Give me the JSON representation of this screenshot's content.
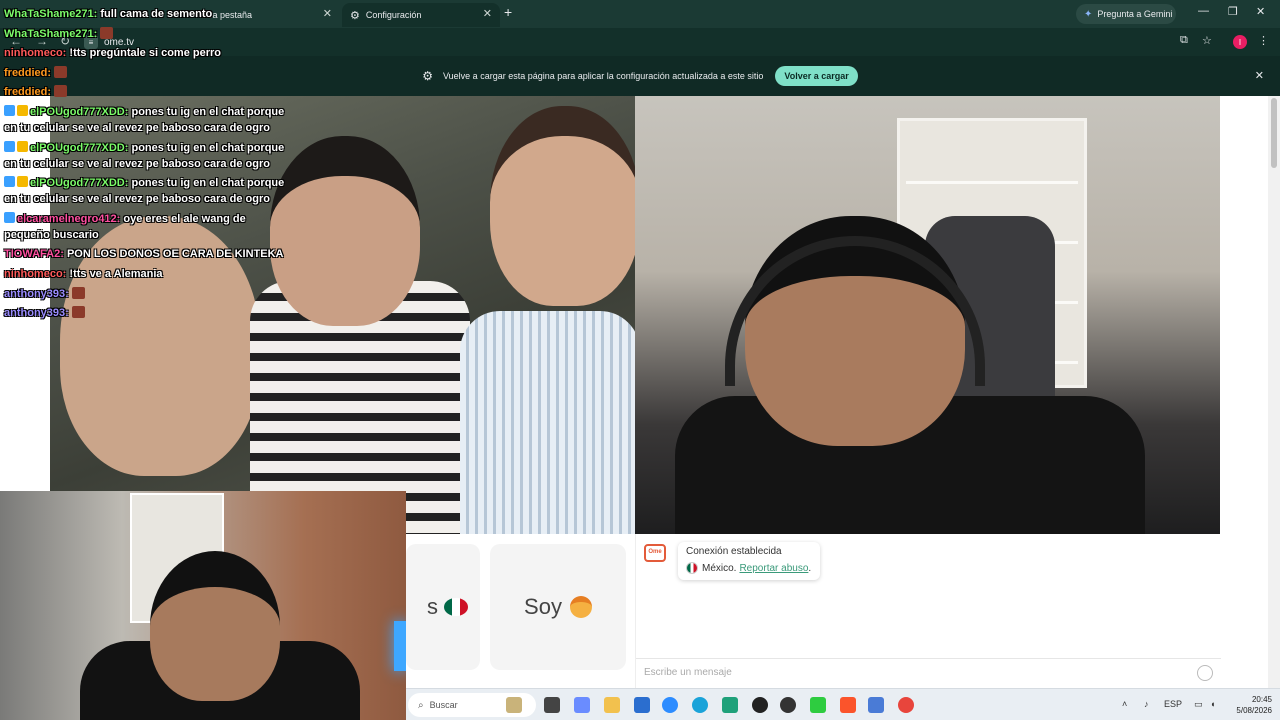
{
  "browser": {
    "tabs": [
      {
        "label": "va pestaña"
      },
      {
        "label": "Configuración"
      }
    ],
    "new_tab": "+",
    "gemini_label": "Pregunta a Gemini",
    "url": "ome.tv",
    "profile_initial": "I",
    "window_controls": {
      "minimize": "—",
      "restore": "❐",
      "close": "✕"
    }
  },
  "infobar": {
    "message": "Vuelve a cargar esta página para aplicar la configuración actualizada a este sitio",
    "reload_button": "Volver a cargar",
    "close": "✕"
  },
  "page": {
    "card_left_text": "s",
    "card_right_text": "Soy",
    "chat": {
      "status_title": "Conexión establecida",
      "country": "México.",
      "report_link": "Reportar abuso",
      "report_suffix": ".",
      "input_placeholder": "Escribe un mensaje"
    }
  },
  "overlay_chat": [
    {
      "user": "WhaTaShame271:",
      "user_color": "#7CFC6A",
      "text": " full cama de semento",
      "badges": 0,
      "emote": false
    },
    {
      "user": "WhaTaShame271:",
      "user_color": "#7CFC6A",
      "text": "",
      "badges": 0,
      "emote": true
    },
    {
      "user": "ninhomeco:",
      "user_color": "#ff5a5a",
      "text": " !tts pregúntale si come perro",
      "badges": 0,
      "emote": false
    },
    {
      "user": "freddied:",
      "user_color": "#ff9a1f",
      "text": "",
      "badges": 0,
      "emote": true
    },
    {
      "user": "freddied:",
      "user_color": "#ff9a1f",
      "text": "",
      "badges": 0,
      "emote": true
    },
    {
      "user": "elPOUgod777XDD:",
      "user_color": "#7CFC6A",
      "text": " pones tu ig en el chat porque en tu celular se ve al revez pe baboso cara de ogro",
      "badges": 2,
      "emote": false
    },
    {
      "user": "elPOUgod777XDD:",
      "user_color": "#7CFC6A",
      "text": " pones tu ig en el chat porque en tu celular se ve al revez pe baboso cara de ogro",
      "badges": 2,
      "emote": false
    },
    {
      "user": "elPOUgod777XDD:",
      "user_color": "#7CFC6A",
      "text": " pones tu ig en el chat porque en tu celular se ve al revez pe baboso cara de ogro",
      "badges": 2,
      "emote": false
    },
    {
      "user": "elcaramelnegro412:",
      "user_color": "#ff4fa0",
      "text": " oye eres el ale wang de pequeño buscario",
      "badges": 1,
      "emote": false
    },
    {
      "user": "TIOWAFA2:",
      "user_color": "#ff4fa0",
      "text": " PON LOS DONOS OE CARA DE KINTEKA",
      "badges": 0,
      "emote": false
    },
    {
      "user": "ninhomeco:",
      "user_color": "#ff5a5a",
      "text": " !tts ve a Alemania",
      "badges": 0,
      "emote": false
    },
    {
      "user": "anthony393:",
      "user_color": "#9a8cff",
      "text": "",
      "badges": 0,
      "emote": true
    },
    {
      "user": "anthony393:",
      "user_color": "#9a8cff",
      "text": "",
      "badges": 0,
      "emote": true
    }
  ],
  "taskbar": {
    "search_placeholder": "Buscar",
    "language": "ESP",
    "time": "20:45",
    "date": "5/08/2026"
  }
}
